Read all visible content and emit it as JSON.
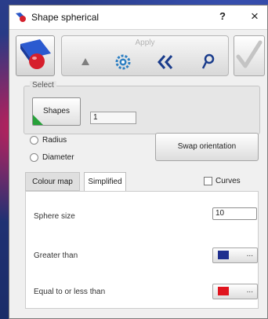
{
  "window": {
    "title": "Shape spherical",
    "help_label": "?",
    "close_label": "×"
  },
  "toolbar": {
    "apply_label": "Apply"
  },
  "select": {
    "legend": "Select",
    "shapes_label": "Shapes",
    "count_value": "1"
  },
  "options": {
    "radius_label": "Radius",
    "diameter_label": "Diameter",
    "swap_label": "Swap orientation"
  },
  "tabs": [
    {
      "label": "Colour map"
    },
    {
      "label": "Simplified"
    }
  ],
  "curves_label": "Curves",
  "params": {
    "sphere_size_label": "Sphere size",
    "sphere_size_value": "10",
    "greater_label": "Greater than",
    "greater_color": "#1f2f8f",
    "less_label": "Equal to or less than",
    "less_color": "#e0141e",
    "more_label": "..."
  }
}
